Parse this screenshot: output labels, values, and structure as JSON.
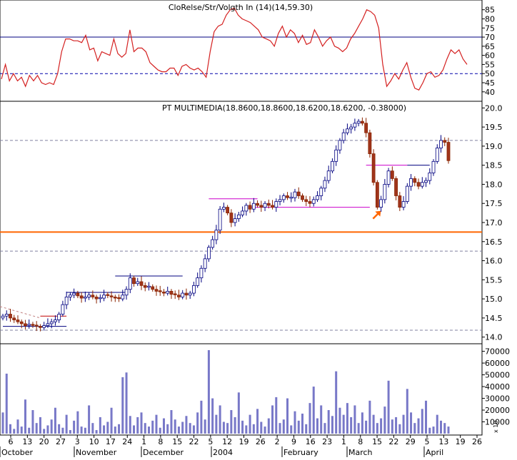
{
  "chart_data": [
    {
      "type": "line",
      "panel": "indicator",
      "title": "Relative Strength Index (14)",
      "title_overlap_artifact": "CloRelse/Str/Volgth In (14)(14,59.30)",
      "yticks": [
        40,
        45,
        50,
        55,
        60,
        65,
        70,
        75,
        80,
        85
      ],
      "ylim": [
        36,
        88
      ],
      "reference_lines": [
        {
          "value": 70,
          "style": "solid",
          "color": "#00007f"
        },
        {
          "value": 50,
          "style": "dashed",
          "color": "#0000aa"
        }
      ],
      "series": [
        {
          "color": "#d42020",
          "values": [
            47,
            55,
            46,
            50,
            46,
            48,
            43,
            49,
            46,
            49,
            45,
            44,
            45,
            44,
            50,
            62,
            69,
            69,
            68,
            68,
            67,
            71,
            63,
            64,
            57,
            62,
            61,
            60,
            69,
            61,
            59,
            61,
            74,
            62,
            64,
            64,
            62,
            56,
            54,
            52,
            51,
            51,
            53,
            53,
            49,
            54,
            55,
            53,
            52,
            53,
            51,
            48,
            62,
            73,
            76,
            77,
            82,
            85,
            86,
            82,
            80,
            79,
            78,
            76,
            74,
            70,
            69,
            68,
            65,
            72,
            76,
            70,
            74,
            72,
            67,
            71,
            66,
            67,
            74,
            70,
            65,
            68,
            70,
            65,
            64,
            62,
            64,
            69,
            72,
            76,
            80,
            85,
            84,
            82,
            75,
            55,
            43,
            46,
            50,
            47,
            52,
            56,
            48,
            42,
            41,
            45,
            50,
            51,
            48,
            49,
            52,
            58,
            63,
            61,
            63,
            58,
            55
          ]
        }
      ]
    },
    {
      "type": "candlestick",
      "panel": "price",
      "title": "PT MULTIMEDIA(18.8600,18.8600,18.6200,18.6200, -0.38000)",
      "yticks": [
        14.0,
        14.5,
        15.0,
        15.5,
        16.0,
        16.5,
        17.0,
        17.5,
        18.0,
        18.5,
        19.0,
        19.5,
        20.0
      ],
      "ylim": [
        13.9,
        20.1
      ],
      "closes": [
        14.55,
        14.6,
        14.5,
        14.45,
        14.4,
        14.35,
        14.3,
        14.32,
        14.3,
        14.28,
        14.25,
        14.3,
        14.35,
        14.4,
        14.45,
        14.6,
        14.85,
        15.05,
        15.1,
        15.15,
        15.08,
        15.02,
        15.05,
        15.1,
        15.05,
        15.0,
        15.02,
        15.1,
        15.08,
        15.05,
        15.02,
        15.0,
        15.1,
        15.25,
        15.55,
        15.4,
        15.45,
        15.35,
        15.3,
        15.32,
        15.25,
        15.2,
        15.18,
        15.15,
        15.2,
        15.12,
        15.1,
        15.05,
        15.15,
        15.1,
        15.15,
        15.35,
        15.55,
        15.8,
        16.05,
        16.35,
        16.55,
        16.8,
        17.35,
        17.4,
        17.25,
        17.0,
        17.1,
        17.2,
        17.3,
        17.45,
        17.35,
        17.5,
        17.45,
        17.4,
        17.5,
        17.45,
        17.4,
        17.55,
        17.6,
        17.7,
        17.65,
        17.65,
        17.8,
        17.7,
        17.6,
        17.55,
        17.5,
        17.6,
        17.7,
        17.9,
        18.1,
        18.35,
        18.6,
        18.9,
        19.15,
        19.35,
        19.45,
        19.5,
        19.6,
        19.65,
        19.6,
        19.35,
        18.8,
        18.05,
        17.4,
        17.6,
        18.0,
        18.35,
        18.15,
        17.7,
        17.4,
        17.55,
        17.95,
        18.15,
        18.05,
        17.95,
        18.05,
        18.1,
        18.3,
        18.6,
        18.95,
        19.15,
        19.1,
        18.62
      ],
      "reference_lines": [
        {
          "value": 16.75,
          "style": "solid",
          "color": "#ff6600"
        },
        {
          "value": 19.15,
          "style": "dashed",
          "color": "#8080a0"
        },
        {
          "value": 16.25,
          "style": "dashed",
          "color": "#8080a0"
        },
        {
          "value": 14.18,
          "style": "dashed",
          "color": "#8080a0"
        }
      ],
      "annotations": [
        "support/resistance segments",
        "orange arrow near March 22"
      ]
    },
    {
      "type": "bar",
      "panel": "volume",
      "yticks": [
        10000,
        20000,
        30000,
        40000,
        50000,
        60000,
        70000
      ],
      "ylim": [
        0,
        74000
      ],
      "axis_multiplier": "x 10",
      "values": [
        18000,
        51000,
        8000,
        4000,
        12000,
        6000,
        29000,
        5000,
        20000,
        9000,
        14000,
        4000,
        7000,
        12000,
        22000,
        8000,
        5000,
        16000,
        3000,
        11000,
        19000,
        6000,
        5000,
        24000,
        9000,
        3000,
        14000,
        7000,
        10000,
        22000,
        6000,
        8000,
        48000,
        52000,
        15000,
        7000,
        14000,
        18000,
        9000,
        6000,
        11000,
        16000,
        5000,
        13000,
        8000,
        20000,
        12000,
        6000,
        10000,
        15000,
        9000,
        7000,
        18000,
        28000,
        12000,
        71000,
        30000,
        16000,
        24000,
        10000,
        9000,
        20000,
        14000,
        35000,
        11000,
        7000,
        16000,
        8000,
        21000,
        10000,
        6000,
        13000,
        24000,
        31000,
        9000,
        12000,
        30000,
        7000,
        19000,
        11000,
        17000,
        8000,
        26000,
        40000,
        13000,
        24000,
        9000,
        20000,
        15000,
        53000,
        22000,
        16000,
        26000,
        14000,
        24000,
        9000,
        18000,
        11000,
        28000,
        16000,
        9000,
        13000,
        23000,
        45000,
        12000,
        14000,
        8000,
        16000,
        38000,
        18000,
        9000,
        13000,
        21000,
        28000,
        5000,
        6000,
        16000,
        11000,
        9000,
        6000
      ]
    }
  ],
  "x_axis": {
    "day_labels": [
      "6",
      "13",
      "20",
      "27",
      "3",
      "10",
      "17",
      "24",
      "1",
      "8",
      "15",
      "22",
      "5",
      "12",
      "19",
      "26",
      "2",
      "9",
      "16",
      "23",
      "1",
      "8",
      "15",
      "22",
      "29",
      "5",
      "13",
      "19",
      "26"
    ],
    "month_labels": [
      "October",
      "November",
      "December",
      "2004",
      "February",
      "March",
      "April"
    ]
  }
}
